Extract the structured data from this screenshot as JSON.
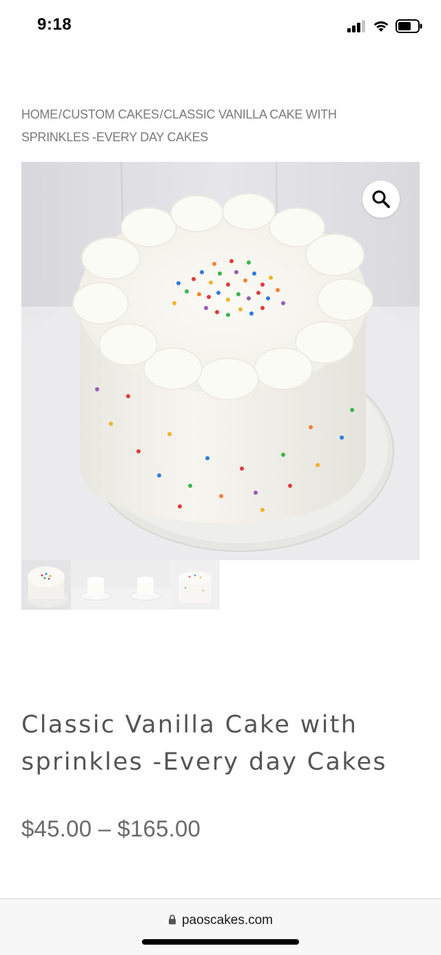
{
  "status_bar": {
    "time": "9:18",
    "icons": [
      "cellular-signal-icon",
      "wifi-icon",
      "battery-icon"
    ]
  },
  "breadcrumb": {
    "items": [
      {
        "label": "HOME"
      },
      {
        "label": "CUSTOM CAKES"
      },
      {
        "label": "CLASSIC VANILLA CAKE WITH SPRINKLES -EVERY DAY CAKES"
      }
    ],
    "separator": "/"
  },
  "product": {
    "title": "Classic Vanilla Cake with sprinkles -Every day Cakes",
    "price": "$45.00 – $165.00",
    "main_image_alt": "vanilla-sprinkle-cake-photo",
    "zoom_icon": "magnifier-icon",
    "thumbnails": [
      {
        "name": "thumb-cake-top-view",
        "active": true
      },
      {
        "name": "thumb-cake-on-stand",
        "active": false
      },
      {
        "name": "thumb-cake-on-stand-2",
        "active": false
      },
      {
        "name": "thumb-cake-front-view",
        "active": false
      }
    ]
  },
  "browser": {
    "url": "paoscakes.com",
    "lock_icon": "lock-icon"
  },
  "colors": {
    "text_gray": "#555555",
    "breadcrumb_gray": "#7a7a7a",
    "price_gray": "#6a6a6a",
    "url_bar_bg": "#f7f7f7"
  }
}
